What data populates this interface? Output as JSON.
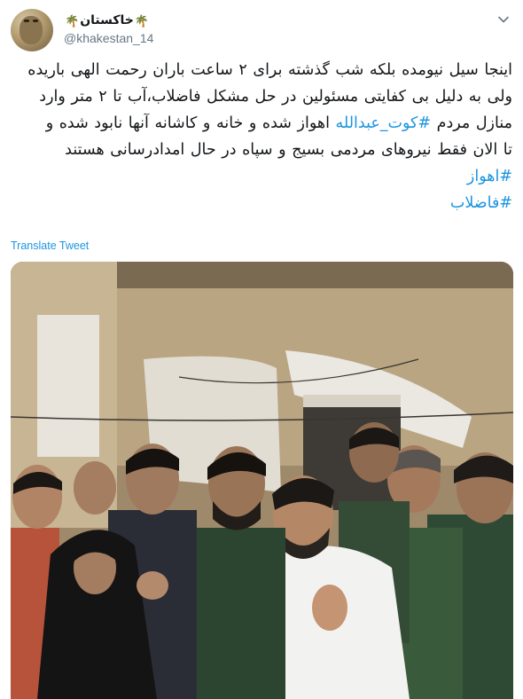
{
  "tweet": {
    "user": {
      "display_name": "خاکستان",
      "handle": "@khakestan_14",
      "name_emoji": "🌴"
    },
    "text_lines": [
      [
        {
          "t": "اینجا سیل نیومده بلکه شب گذشته برای ۲ ساعت باران رحمت الهی باریده"
        }
      ],
      [
        {
          "t": "ولی به دلیل بی کفایتی مسئولین در حل مشکل فاضلاب،آب تا ۲ متر وارد"
        }
      ],
      [
        {
          "t": "منازل مردم "
        },
        {
          "t": "#کوت_عبدالله",
          "tag": true
        },
        {
          "t": " اهواز شده و خانه و کاشانه آنها نابود شده و"
        }
      ],
      [
        {
          "t": "تا الان فقط نیروهای مردمی بسیج و سپاه در حال امدادرسانی هستند"
        }
      ],
      [
        {
          "t": "#اهواز",
          "tag": true
        }
      ],
      [
        {
          "t": "#فاضلاب",
          "tag": true
        }
      ]
    ],
    "translate_label": "Translate Tweet",
    "media": {
      "icon": "photo"
    }
  },
  "colors": {
    "link": "#1b95e0",
    "text": "#14171a",
    "secondary": "#657786"
  }
}
